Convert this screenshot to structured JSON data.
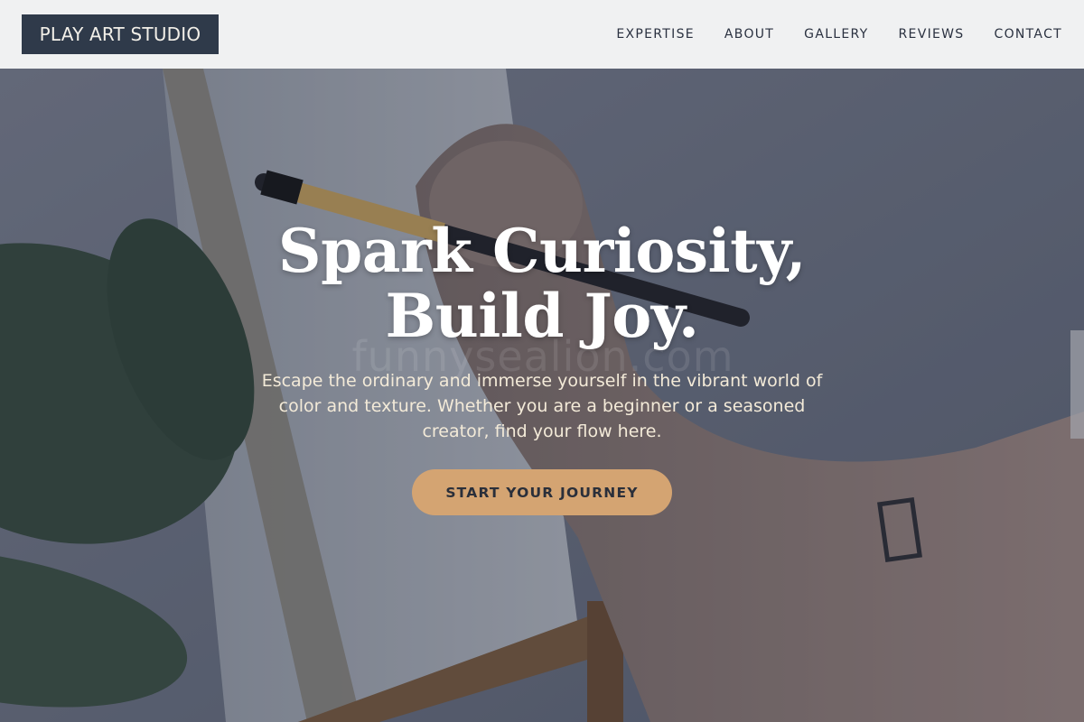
{
  "brand": {
    "logo_text": "PLAY ART STUDIO"
  },
  "nav": {
    "items": [
      {
        "label": "EXPERTISE"
      },
      {
        "label": "ABOUT"
      },
      {
        "label": "GALLERY"
      },
      {
        "label": "REVIEWS"
      },
      {
        "label": "CONTACT"
      }
    ]
  },
  "hero": {
    "headline_line1": "Spark Curiosity,",
    "headline_line2": "Build Joy.",
    "subtext": "Escape the ordinary and immerse yourself in the vibrant world of color and texture. Whether you are a beginner or a seasoned creator, find your flow here.",
    "cta_label": "START YOUR JOURNEY",
    "watermark": "funnysealion.com"
  },
  "colors": {
    "header_bg": "#f0f1f2",
    "logo_bg": "#2f3a4a",
    "nav_text": "#2a3140",
    "cta_bg": "#d4a472",
    "headline": "#ffffff",
    "subtext": "#f3ead8"
  }
}
